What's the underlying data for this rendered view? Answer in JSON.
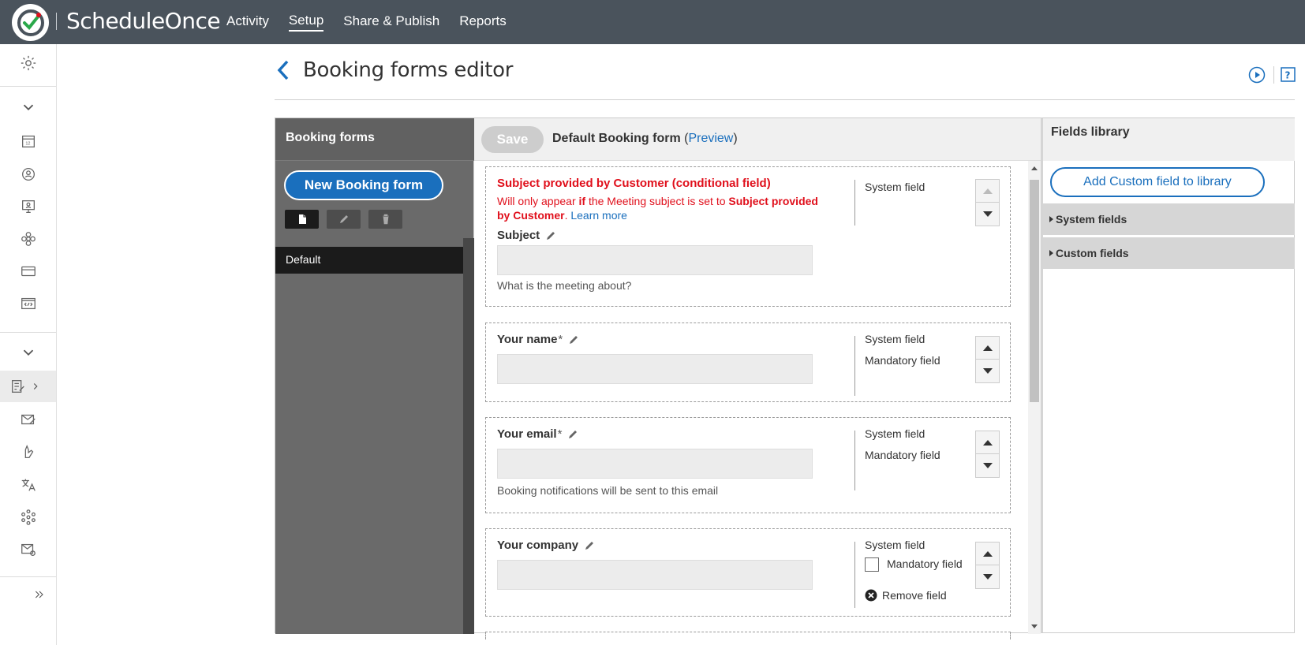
{
  "app": {
    "name": "ScheduleOnce",
    "nav": [
      {
        "label": "Activity",
        "active": false
      },
      {
        "label": "Setup",
        "active": true
      },
      {
        "label": "Share & Publish",
        "active": false
      },
      {
        "label": "Reports",
        "active": false
      }
    ]
  },
  "colors": {
    "topbar": "#4a535c",
    "accent": "#1a6fbd",
    "warning": "#e0101c",
    "panel_dark": "#6a6a6a"
  },
  "sidebar": {
    "icons": [
      "gear-icon",
      "chevron-down-icon",
      "calendar-icon",
      "user-cycle-icon",
      "presenter-icon",
      "flower-icon",
      "card-icon",
      "code-icon",
      "chevron-down-icon",
      "form-edit-icon",
      "mail-edit-icon",
      "hand-icon",
      "translate-icon",
      "integrations-icon",
      "email-at-icon",
      "expand-icon"
    ]
  },
  "page": {
    "title": "Booking forms editor"
  },
  "booking_forms": {
    "title": "Booking forms",
    "new_button": "New Booking form",
    "items": [
      "Default"
    ]
  },
  "editor": {
    "save_label": "Save",
    "form_name": "Default Booking form",
    "preview_open": "(",
    "preview_label": "Preview",
    "preview_close": ")",
    "fields": [
      {
        "conditional_title": "Subject provided by Customer (conditional field)",
        "conditional_text_1": "Will only appear ",
        "conditional_text_if": "if",
        "conditional_text_2": " the Meeting subject is set to ",
        "conditional_text_bold": "Subject provided by Customer",
        "conditional_text_3": ". ",
        "learn_more": "Learn more",
        "label": "Subject",
        "help": "What is the meeting about?",
        "meta": [
          "System field"
        ]
      },
      {
        "label": "Your name",
        "required": "*",
        "meta": [
          "System field",
          "Mandatory field"
        ]
      },
      {
        "label": "Your email",
        "required": "*",
        "help": "Booking notifications will be sent to this email",
        "meta": [
          "System field",
          "Mandatory field"
        ]
      },
      {
        "label": "Your company",
        "meta": [
          "System field"
        ],
        "mandatory_checkbox_label": "Mandatory field",
        "remove_label": "Remove field"
      }
    ]
  },
  "library": {
    "title": "Fields library",
    "add_button": "Add Custom field to library",
    "sections": [
      "System fields",
      "Custom fields"
    ]
  }
}
